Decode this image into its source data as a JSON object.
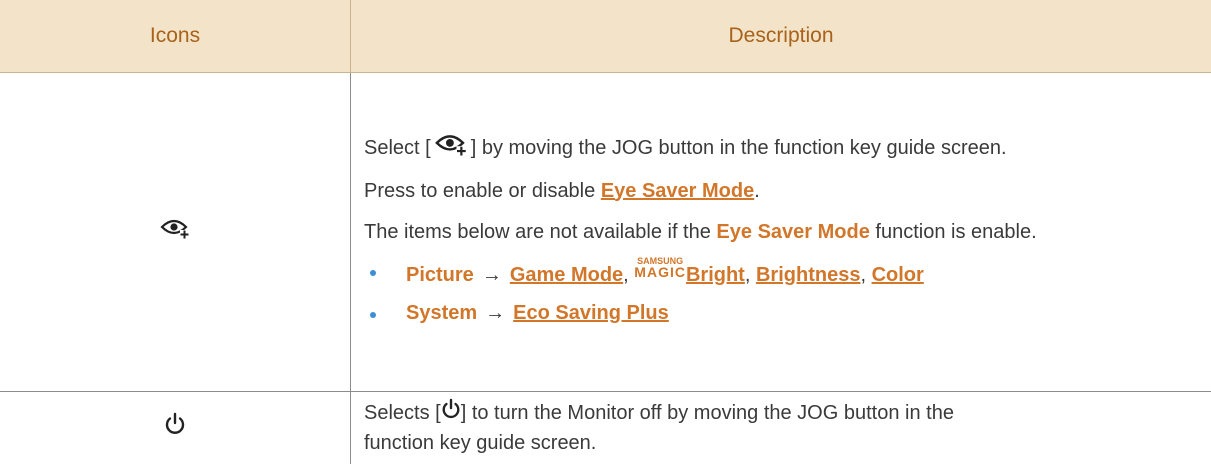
{
  "header": {
    "col1": "Icons",
    "col2": "Description"
  },
  "row1": {
    "icon": "eye-saver-icon",
    "select_prefix": "Select [",
    "select_suffix": "] by moving the JOG button in the function key guide screen.",
    "press_prefix": "Press to enable or disable ",
    "press_link": "Eye Saver Mode",
    "press_suffix": ".",
    "items_prefix": "The items below are not available if the ",
    "items_emph": "Eye Saver Mode",
    "items_suffix": " function is enable.",
    "bullet1": {
      "menu": "Picture",
      "arrow": "→",
      "link1": "Game Mode",
      "sep1": ",",
      "magic_top": "SAMSUNG",
      "magic_bottom": "MAGIC",
      "link2": "Bright",
      "sep2": ",",
      "link3": "Brightness",
      "sep3": ",",
      "link4": "Color"
    },
    "bullet2": {
      "menu": "System",
      "arrow": "→",
      "link1": "Eco Saving Plus"
    }
  },
  "row2": {
    "icon": "power-icon",
    "line_prefix": "Selects [",
    "line_suffix": "] to turn the Monitor off by moving the JOG button in the",
    "line2": "function key guide screen."
  },
  "colors": {
    "header_bg": "#f3e3c8",
    "header_text": "#a8621a",
    "accent": "#d2762a",
    "bullet": "#3c8fd6"
  }
}
